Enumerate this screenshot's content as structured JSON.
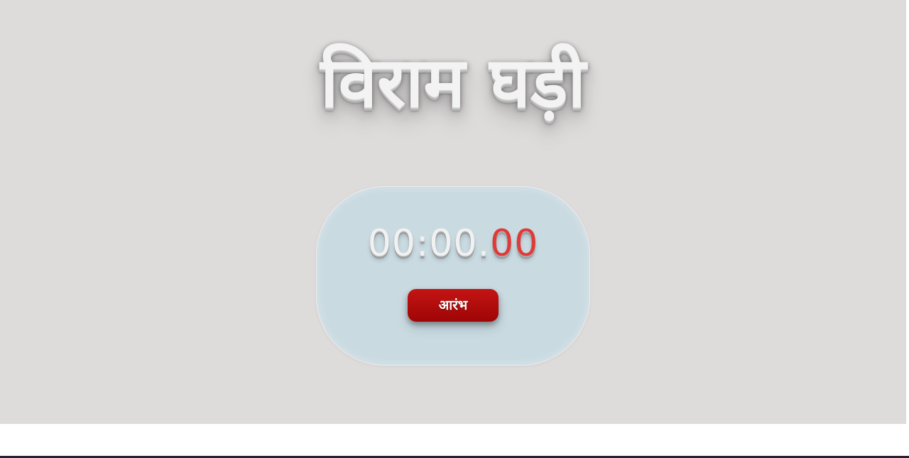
{
  "title": "विराम घड़ी",
  "timer": {
    "main": "00:00.",
    "milliseconds": "00"
  },
  "buttons": {
    "start_label": "आरंभ"
  },
  "colors": {
    "background": "#dedbdb",
    "card": "#c9dae1",
    "button": "#b20d0d",
    "milliseconds": "#e03939"
  }
}
